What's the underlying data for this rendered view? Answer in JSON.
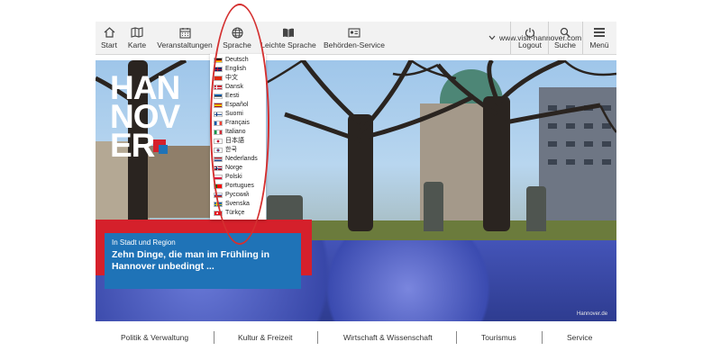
{
  "nav": {
    "start": "Start",
    "karte": "Karte",
    "veranstaltungen": "Veranstaltungen",
    "sprache": "Sprache",
    "leichte_sprache": "Leichte Sprache",
    "behoerden": "Behörden-Service",
    "url": "www.visit-hannover.com",
    "logout": "Logout",
    "suche": "Suche",
    "menue": "Menü"
  },
  "logo": {
    "line1": "HAN",
    "line2": "NOV",
    "line3": "ER"
  },
  "languages": [
    {
      "label": "Deutsch",
      "icon": "flag-de-icon"
    },
    {
      "label": "English",
      "icon": "flag-gb-icon"
    },
    {
      "label": "中文",
      "icon": "flag-cn-icon"
    },
    {
      "label": "Dansk",
      "icon": "flag-dk-icon"
    },
    {
      "label": "Eesti",
      "icon": "flag-ee-icon"
    },
    {
      "label": "Español",
      "icon": "flag-es-icon"
    },
    {
      "label": "Suomi",
      "icon": "flag-fi-icon"
    },
    {
      "label": "Français",
      "icon": "flag-fr-icon"
    },
    {
      "label": "Italiano",
      "icon": "flag-it-icon"
    },
    {
      "label": "日本語",
      "icon": "flag-jp-icon"
    },
    {
      "label": "한국",
      "icon": "flag-kr-icon"
    },
    {
      "label": "Nederlands",
      "icon": "flag-nl-icon"
    },
    {
      "label": "Norge",
      "icon": "flag-no-icon"
    },
    {
      "label": "Polski",
      "icon": "flag-pl-icon"
    },
    {
      "label": "Portugues",
      "icon": "flag-pt-icon"
    },
    {
      "label": "Русский",
      "icon": "flag-ru-icon"
    },
    {
      "label": "Svenska",
      "icon": "flag-se-icon"
    },
    {
      "label": "Türkçe",
      "icon": "flag-tr-icon"
    }
  ],
  "teaser": {
    "kicker": "In Stadt und Region",
    "headline": "Zehn Dinge, die man im Frühling in Hannover unbedingt ..."
  },
  "credit": "Hannover.de",
  "footer": [
    "Politik & Verwaltung",
    "Kultur & Freizeit",
    "Wirtschaft & Wissenschaft",
    "Tourismus",
    "Service"
  ],
  "colors": {
    "brand_red": "#d5202b",
    "brand_blue": "#1f73b7",
    "annotation": "#d43030"
  }
}
